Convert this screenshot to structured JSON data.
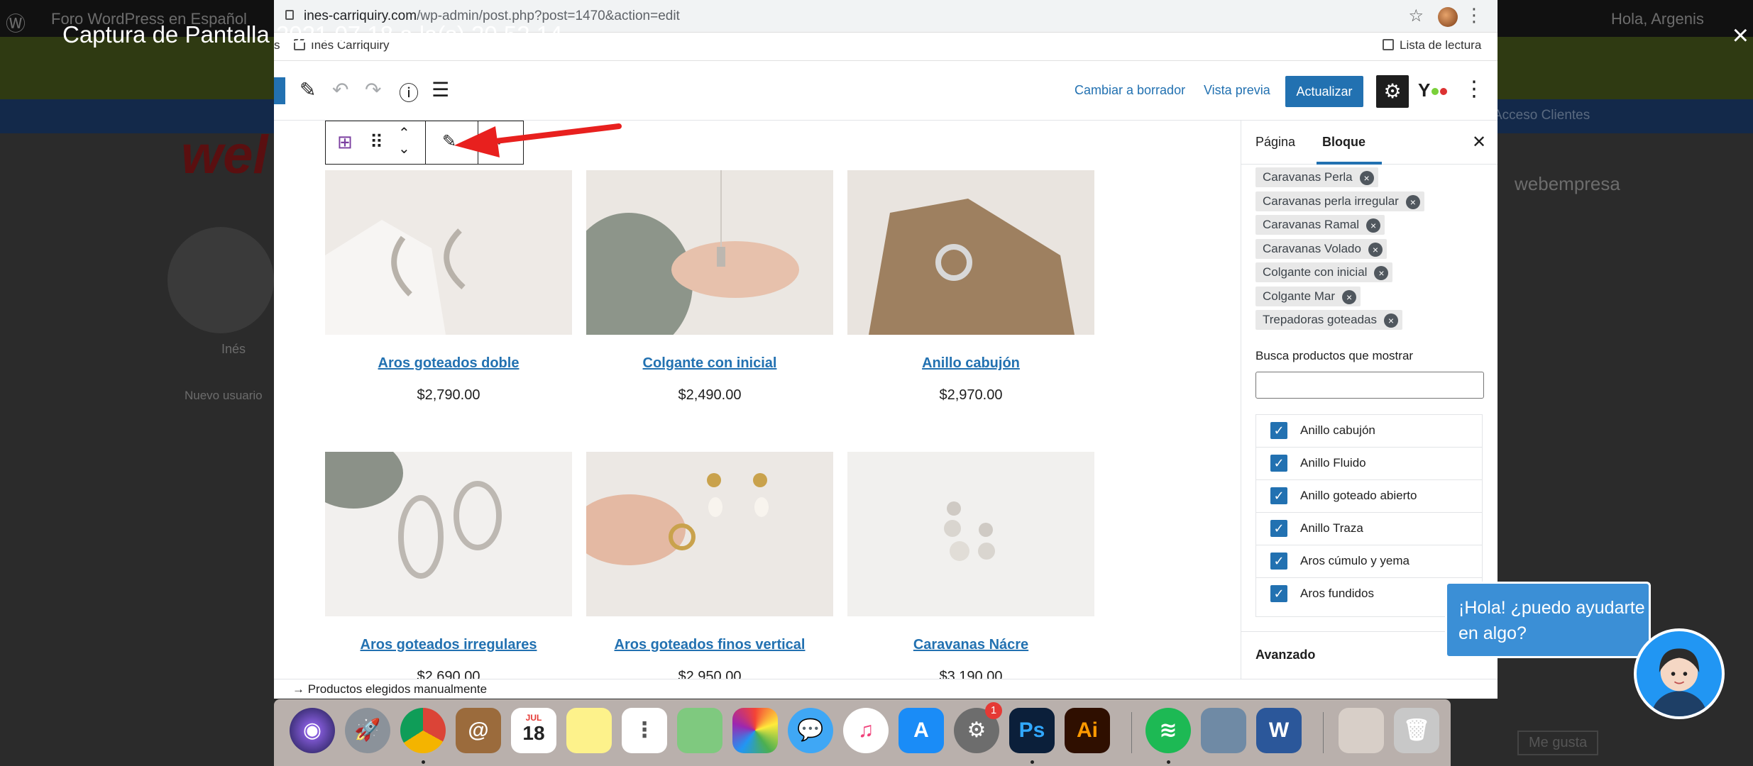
{
  "lightbox": {
    "caption": "Captura de Pantalla 2021 07 18 a la(s) 20.52.14",
    "close": "×"
  },
  "background": {
    "admin_site": "Foro WordPress en Español",
    "greeting": "Hola, Argenis",
    "nav_right": "Acceso Clientes",
    "site_name": "webempresa",
    "user_name": "Inés",
    "user_role": "Nuevo usuario",
    "like_button": "Me gusta",
    "logo": "wel"
  },
  "browser": {
    "url_host": "ines-carriquiry.com",
    "url_path": "/wp-admin/post.php?post=1470&action=edit",
    "bookmark_partial": "s",
    "bookmark_site": "Inés Carriquiry",
    "reading_list": "Lista de lectura"
  },
  "editor": {
    "switch_draft": "Cambiar a borrador",
    "preview": "Vista previa",
    "update": "Actualizar",
    "footer_breadcrumb": "→  Productos elegidos manualmente"
  },
  "products": [
    {
      "name": "Aros goteados doble",
      "price": "$2,790.00"
    },
    {
      "name": "Colgante con inicial",
      "price": "$2,490.00"
    },
    {
      "name": "Anillo cabujón",
      "price": "$2,970.00"
    },
    {
      "name": "Aros goteados irregulares",
      "price": "$2,690.00"
    },
    {
      "name": "Aros goteados finos vertical",
      "price": "$2,950.00"
    },
    {
      "name": "Caravanas Nácre",
      "price": "$3,190.00"
    }
  ],
  "sidebar": {
    "tab_page": "Página",
    "tab_block": "Bloque",
    "tags": [
      "Caravanas Perla",
      "Caravanas perla irregular",
      "Caravanas Ramal",
      "Caravanas Volado",
      "Colgante con inicial",
      "Colgante Mar",
      "Trepadoras goteadas"
    ],
    "search_label": "Busca productos que mostrar",
    "search_value": "",
    "checked_items": [
      "Anillo cabujón",
      "Anillo Fluido",
      "Anillo goteado abierto",
      "Anillo Traza",
      "Aros cúmulo y yema",
      "Aros fundidos"
    ],
    "advanced": "Avanzado"
  },
  "chat": {
    "message": "¡Hola! ¿puedo ayudarte en algo?"
  },
  "dock": {
    "badge_count": "1",
    "calendar_month": "JUL",
    "calendar_day": "18",
    "ps_label": "Ps",
    "ai_label": "Ai",
    "word_label": "W"
  },
  "colors": {
    "wp_blue": "#2271b1",
    "arrow_red": "#e8201e",
    "chat_blue": "#3b8fd6"
  }
}
